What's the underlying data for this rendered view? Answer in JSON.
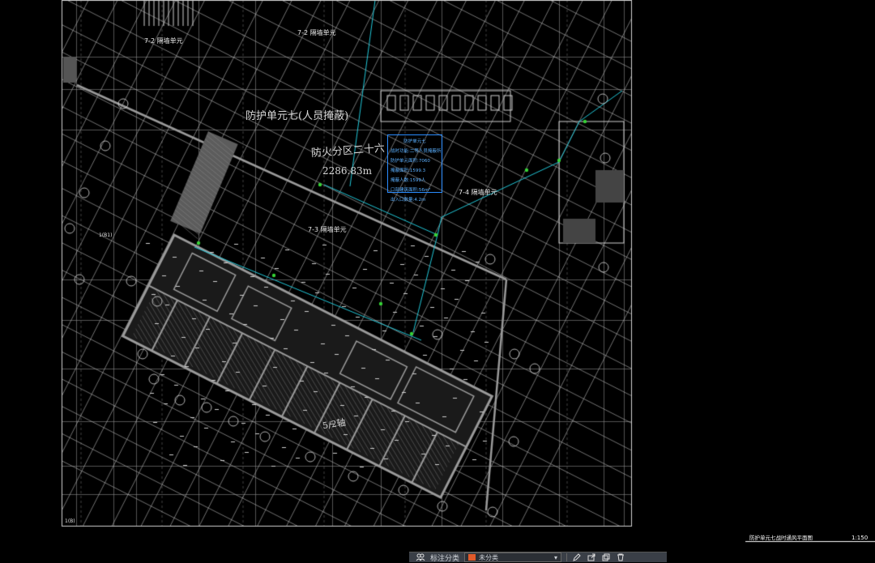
{
  "drawing": {
    "unit_label": "防护单元七(人员掩蔽)",
    "zone_label": "防火分区二十六",
    "area_label": "2286.83m",
    "upper_label_a": "7-2 隔墙单元",
    "upper_label_b": "7-2 隔墙单元",
    "mid_label": "7-3 隔墙单元",
    "right_label": "7-4 隔墙单元",
    "south_area_label": "5/2轴",
    "bottom_left_tag": "1(B)",
    "axis_label_left": "1(B1)"
  },
  "legend": {
    "title": "防护单元七",
    "lines": [
      "战时功能:二等人员掩蔽所",
      "防护单元面积:7060",
      "掩蔽面积:1599.3",
      "掩蔽人数:1599人",
      "口部建筑面积:56m²",
      "出入口数量:4.2m"
    ]
  },
  "title_block": {
    "sheet_title": "防护单元七战时通风平面图",
    "scale": "1:150"
  },
  "toolbar": {
    "annotate_label": "标注分类",
    "layer_value": "未分类",
    "icons": [
      "people-icon",
      "pencil-icon",
      "export-icon",
      "copy-icon",
      "trash-icon"
    ]
  },
  "colors": {
    "wall": "#9a9a9a",
    "grid": "#bfbfbf",
    "duct_cyan": "#21c7d8",
    "equipment_green": "#37d437",
    "legend_blue": "#2a8cff",
    "background": "#000000"
  }
}
